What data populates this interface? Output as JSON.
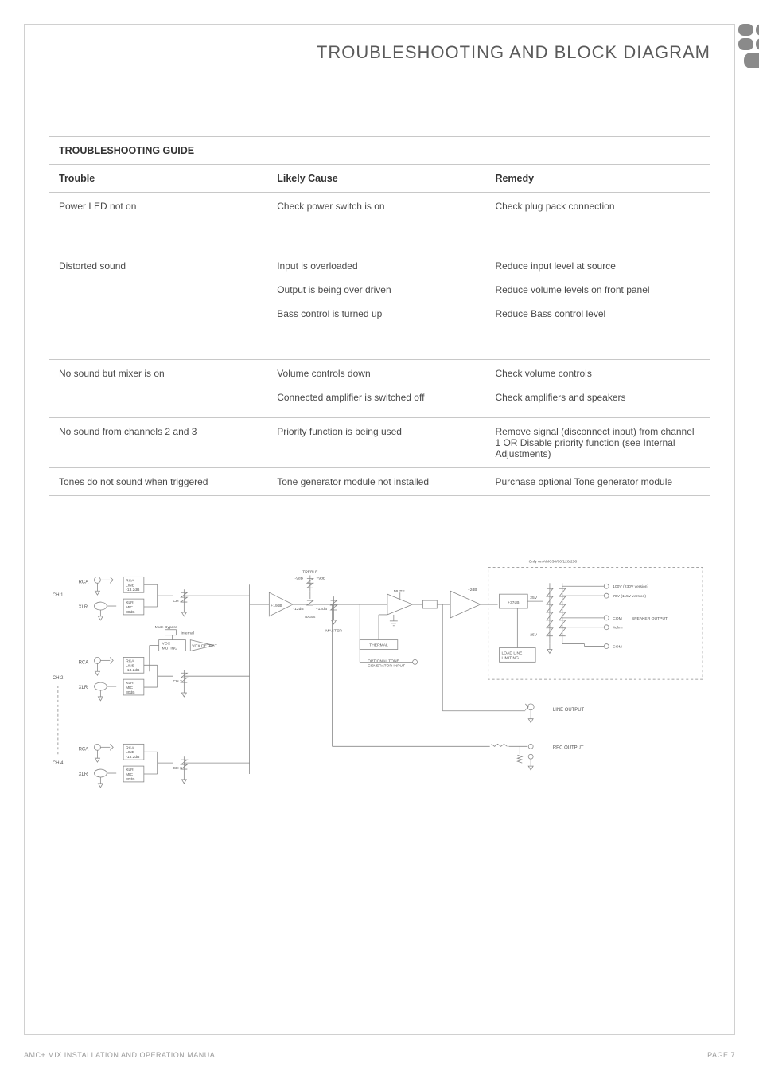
{
  "header": {
    "title": "TROUBLESHOOTING AND BLOCK DIAGRAM"
  },
  "table": {
    "section_label": "TROUBLESHOOTING GUIDE",
    "col_trouble": "Trouble",
    "col_cause": "Likely Cause",
    "col_remedy": "Remedy",
    "rows": [
      {
        "trouble": "Power LED not on",
        "causes": [
          "Check power switch is on"
        ],
        "remedies": [
          "Check plug pack connection"
        ]
      },
      {
        "trouble": "Distorted sound",
        "causes": [
          "Input is overloaded",
          "Output is being over driven",
          "Bass control is turned up"
        ],
        "remedies": [
          "Reduce input level at source",
          "Reduce volume levels on front panel",
          "Reduce Bass control level"
        ]
      },
      {
        "trouble": "No sound but mixer is on",
        "causes": [
          "Volume controls down",
          "Connected amplifier is switched off"
        ],
        "remedies": [
          "Check volume controls",
          "Check amplifiers and speakers"
        ]
      },
      {
        "trouble": "No sound from channels 2 and 3",
        "causes": [
          "Priority function is being used"
        ],
        "remedies": [
          "Remove signal (disconnect input) from channel 1 OR Disable priority function (see Internal Adjustments)"
        ]
      },
      {
        "trouble": "Tones do not sound when triggered",
        "causes": [
          "Tone generator module not installed"
        ],
        "remedies": [
          "Purchase optional Tone generator module"
        ]
      }
    ]
  },
  "diagram": {
    "top_note": "Only on AMC30/60/120/250",
    "ch_labels": [
      "CH 1",
      "CH 2",
      "CH 4"
    ],
    "conn_rca": "RCA",
    "conn_xlr": "XLR",
    "gain_rca": "RCA\nLINE\n-13.2dB",
    "gain_xlr": "XLR\nMIC\n30dB",
    "ch1_knob": "CH 1",
    "ch2_knob": "CH 2",
    "ch3_knob": "CH 3",
    "mute_bypass": "Mute Bypass",
    "vox_muting": "VOX\nMUTING",
    "internal": "Internal",
    "vox_detect": "VOX DETECT",
    "preamp_gain": "+19dB",
    "treble_lbl": "TREBLE",
    "treble_rng": "-9dB            +9dB",
    "bass_lbl": "BASS",
    "bass_rng": "-12dB           +12dB",
    "master": "MASTER",
    "mute_amp": "MUTE",
    "thermal": "THERMAL",
    "tone_in": "OPTIONAL TONE\nGENERATOR INPUT",
    "plus2db": "+2dB",
    "plus37db": "+37dB",
    "tap25_1": "25V",
    "tap25_2": "25V",
    "load_lim": "LOAD LINE\nLIMITING",
    "out_100v": "100V (230V version)",
    "out_70v": "70V (115V version)",
    "out_com1": "COM",
    "out_4ohm": "4ohm",
    "out_com2": "COM",
    "out_speaker": "SPEAKER OUTPUT",
    "line_out": "LINE OUTPUT",
    "rec_out": "REC OUTPUT"
  },
  "footer": {
    "left": "AMC+ MIX INSTALLATION AND OPERATION MANUAL",
    "right": "PAGE 7"
  }
}
